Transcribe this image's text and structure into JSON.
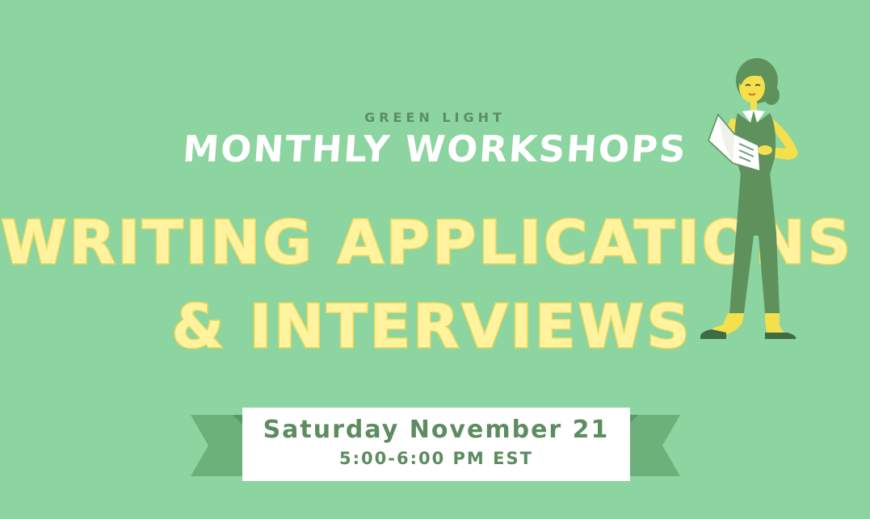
{
  "header": {
    "brand": "GREEN LIGHT",
    "series": "MONTHLY WORKSHOPS"
  },
  "headline": {
    "line1": "WRITING APPLICATIONS",
    "line2": "& INTERVIEWS"
  },
  "event": {
    "date": "Saturday November 21",
    "time": "5:00-6:00 PM EST"
  },
  "colors": {
    "background": "#8cd4a0",
    "headline_fill": "#fff3a0",
    "headline_outline": "#f2da58",
    "ribbon": "#6cb07a",
    "text_green": "#5c8c5f"
  },
  "illustration": {
    "icon": "woman-reading-document-illustration"
  }
}
